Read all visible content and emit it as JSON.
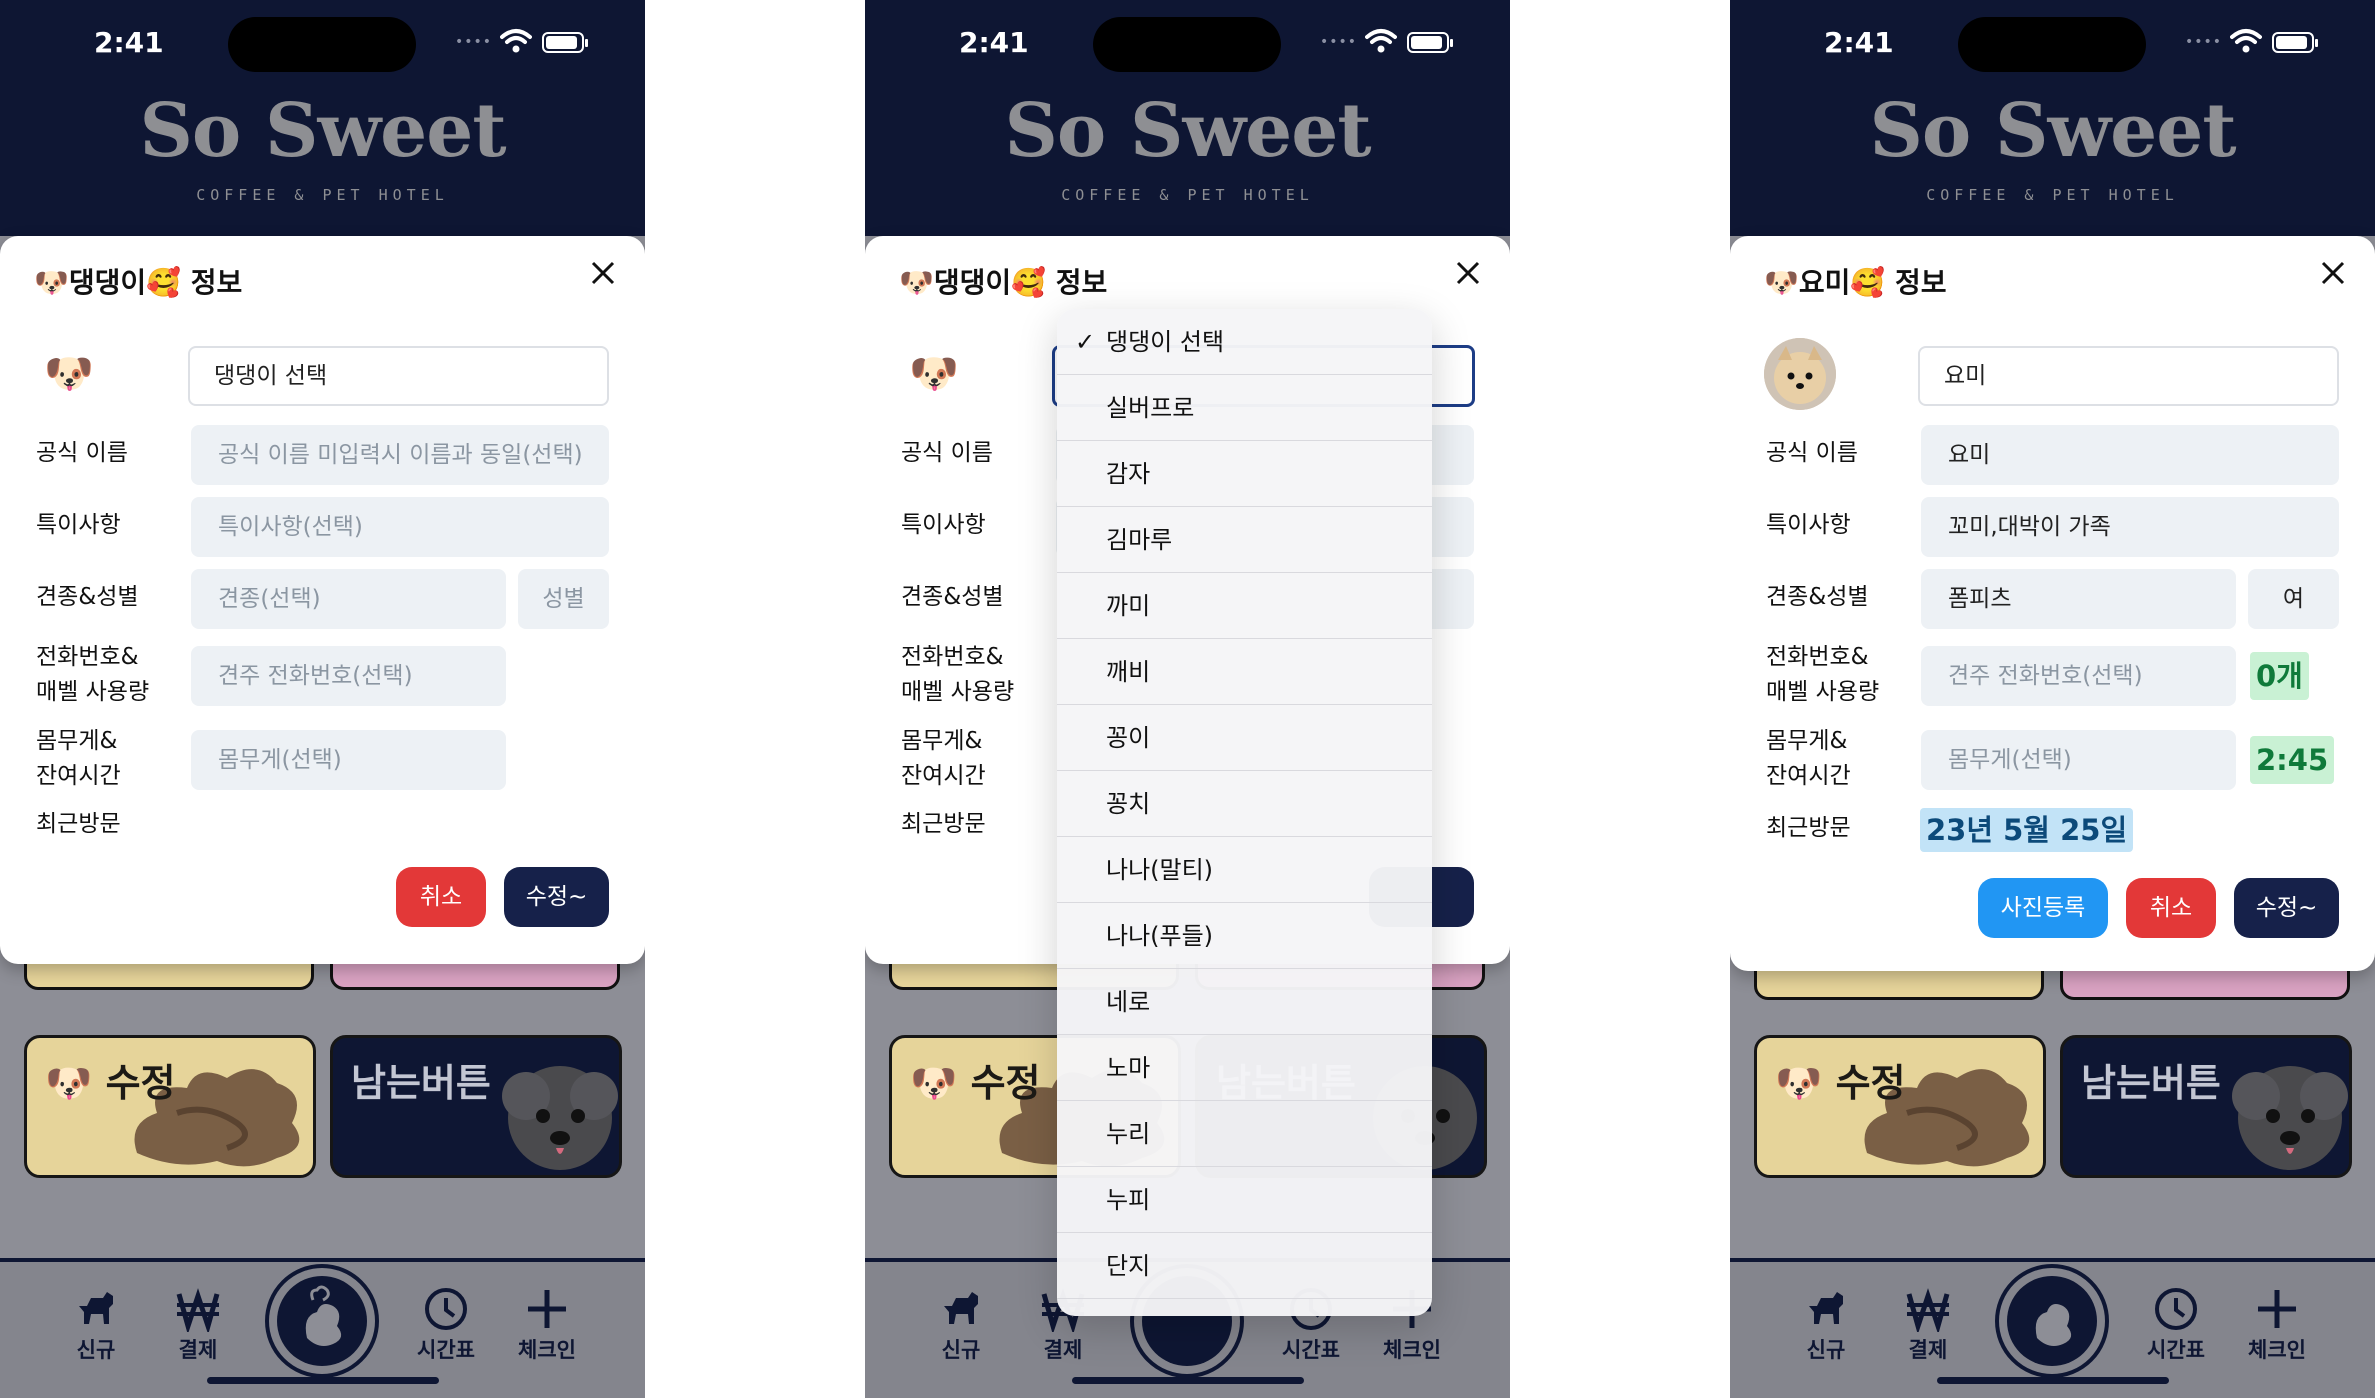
{
  "status": {
    "time": "2:41"
  },
  "brand": {
    "name": "So Sweet",
    "tagline": "COFFEE & PET HOTEL"
  },
  "labels": {
    "official_name": "공식 이름",
    "notes": "특이사항",
    "breed_gender": "견종&성별",
    "phone_line1": "전화번호&",
    "phone_line2": "매벨 사용량",
    "weight_line1": "몸무게&",
    "weight_line2": "잔여시간",
    "last_visit": "최근방문"
  },
  "placeholders": {
    "official_name": "공식 이름 미입력시 이름과 동일(선택)",
    "notes": "특이사항(선택)",
    "breed": "견종(선택)",
    "gender": "성별",
    "phone": "견주 전화번호(선택)",
    "weight": "몸무게(선택)"
  },
  "buttons": {
    "cancel": "취소",
    "edit": "수정~",
    "photo": "사진등록"
  },
  "cards": {
    "edit": "수정",
    "remaining": "남는버튼"
  },
  "tabs": {
    "new": "신규",
    "payment": "결제",
    "schedule": "시간표",
    "checkin": "체크인"
  },
  "screen1": {
    "title_prefix": "🐶댕댕이🥰 정보",
    "select_value": "댕댕이 선택"
  },
  "screen2": {
    "title_prefix": "🐶댕댕이🥰 정보",
    "dropdown": {
      "selected": "댕댕이 선택",
      "options": [
        "댕댕이 선택",
        "실버프로",
        "감자",
        "김마루",
        "까미",
        "깨비",
        "꽁이",
        "꽁치",
        "나나(말티)",
        "나나(푸들)",
        "네로",
        "노마",
        "누리",
        "누피",
        "단지"
      ]
    }
  },
  "screen3": {
    "title_prefix": "🐶요미🥰 정보",
    "select_value": "요미",
    "official_name": "요미",
    "notes": "꼬미,대박이 가족",
    "breed": "폼피츠",
    "gender": "여",
    "bell_usage": "0개",
    "remaining_time": "2:45",
    "last_visit": "23년 5월 25일"
  }
}
